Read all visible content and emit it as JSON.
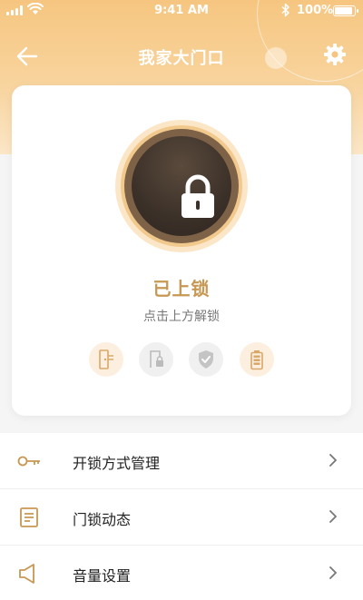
{
  "status_bar": {
    "time": "9:41 AM",
    "battery": "100%",
    "battery_level": 1.0
  },
  "nav": {
    "title": "我家大门口"
  },
  "lock": {
    "status": "已上锁",
    "hint": "点击上方解锁"
  },
  "status_icons": [
    "door-sensor-icon",
    "door-lock-icon",
    "shield-check-icon",
    "battery-icon"
  ],
  "menu": {
    "items": [
      {
        "label": "开锁方式管理",
        "icon": "key-icon"
      },
      {
        "label": "门锁动态",
        "icon": "log-icon"
      },
      {
        "label": "音量设置",
        "icon": "speaker-icon"
      }
    ]
  },
  "colors": {
    "accent": "#c79853",
    "header": "#f6c680",
    "lock_dark": "#3c3129"
  }
}
